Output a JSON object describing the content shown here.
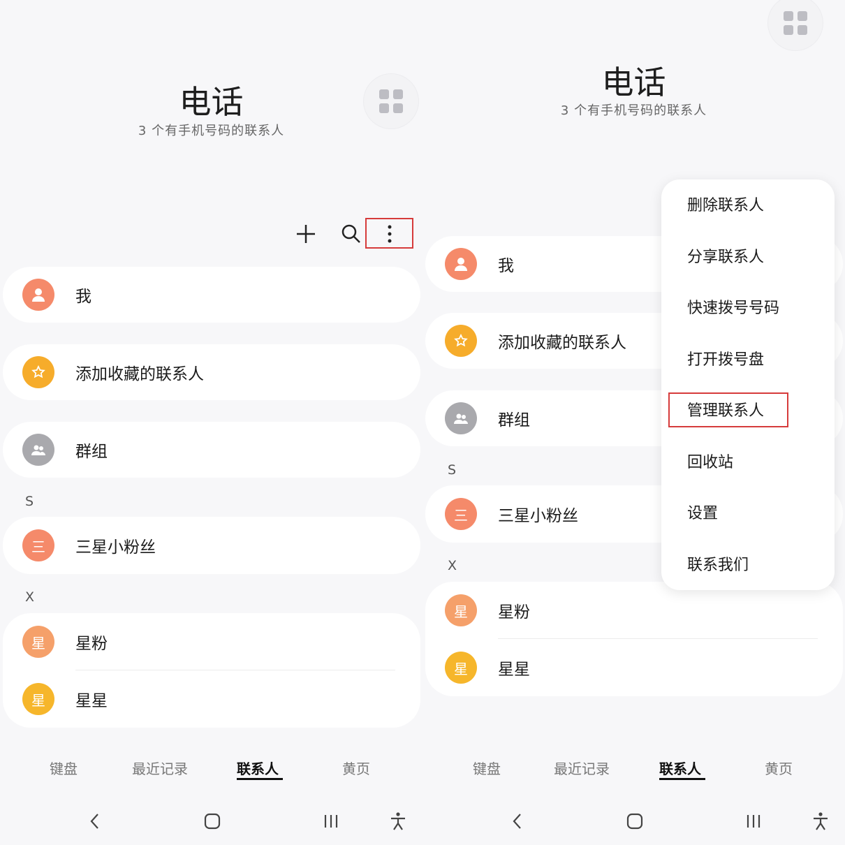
{
  "left": {
    "title": "电话",
    "subtitle": "3 个有手机号码的联系人",
    "toolbar": {
      "add_icon": "plus-icon",
      "search_icon": "search-icon",
      "more_icon": "more-vertical-icon"
    },
    "special_rows": [
      {
        "label": "我",
        "icon": "person-icon",
        "color": "#f58a6a"
      },
      {
        "label": "添加收藏的联系人",
        "icon": "star-icon",
        "color": "#f6ac2b"
      },
      {
        "label": "群组",
        "icon": "group-icon",
        "color": "#a9a9ad"
      }
    ],
    "sections": [
      {
        "header": "S",
        "contacts": [
          {
            "name": "三星小粉丝",
            "avatar_text": "三",
            "color": "#f58a6a"
          }
        ]
      },
      {
        "header": "X",
        "contacts": [
          {
            "name": "星粉",
            "avatar_text": "星",
            "color": "#f5a06a"
          },
          {
            "name": "星星",
            "avatar_text": "星",
            "color": "#f6b62b"
          }
        ]
      }
    ],
    "tabs": [
      "键盘",
      "最近记录",
      "联系人",
      "黄页"
    ],
    "active_tab": "联系人"
  },
  "right": {
    "title": "电话",
    "subtitle": "3 个有手机号码的联系人",
    "special_rows": [
      {
        "label": "我",
        "icon": "person-icon",
        "color": "#f58a6a"
      },
      {
        "label": "添加收藏的联系人",
        "icon": "star-icon",
        "color": "#f6ac2b"
      },
      {
        "label": "群组",
        "icon": "group-icon",
        "color": "#a9a9ad"
      }
    ],
    "sections": [
      {
        "header": "S",
        "contacts": [
          {
            "name": "三星小粉丝",
            "avatar_text": "三",
            "color": "#f58a6a"
          }
        ]
      },
      {
        "header": "X",
        "contacts": [
          {
            "name": "星粉",
            "avatar_text": "星",
            "color": "#f5a06a"
          },
          {
            "name": "星星",
            "avatar_text": "星",
            "color": "#f6b62b"
          }
        ]
      }
    ],
    "menu": {
      "items": [
        "删除联系人",
        "分享联系人",
        "快速拨号号码",
        "打开拨号盘",
        "管理联系人",
        "回收站",
        "设置",
        "联系我们"
      ],
      "highlighted": "管理联系人"
    },
    "tabs": [
      "键盘",
      "最近记录",
      "联系人",
      "黄页"
    ],
    "active_tab": "联系人"
  },
  "nav_icons": [
    "back-icon",
    "home-icon",
    "recents-icon",
    "accessibility-icon"
  ],
  "colors": {
    "highlight": "#d63b3b",
    "accent_orange": "#f58a6a",
    "accent_yellow": "#f6ac2b"
  }
}
